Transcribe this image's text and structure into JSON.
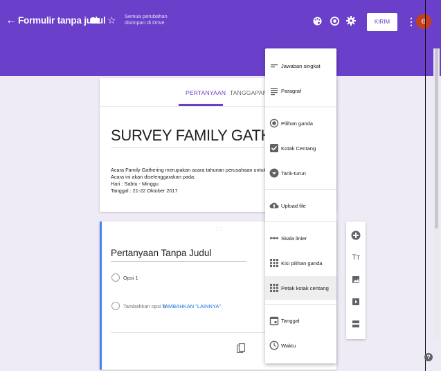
{
  "header": {
    "back_glyph": "←",
    "form_title": "Formulir tanpa judul",
    "star_glyph": "☆",
    "save_status": "Semua perubahan disimpan di Drive",
    "send_label": "KIRIM",
    "more_glyph": "⋮",
    "avatar_letter": "e",
    "icons": [
      "back-arrow-icon",
      "folder-icon",
      "star-icon",
      "palette-icon",
      "eye-icon",
      "gear-icon",
      "more-vert-icon"
    ],
    "colors": {
      "theme": "#6a3fc9",
      "avatar": "#c5401a",
      "background": "#efebf6"
    }
  },
  "tabs": [
    {
      "label": "PERTANYAAN",
      "active": true
    },
    {
      "label": "TANGGAPAN",
      "active": false
    }
  ],
  "form": {
    "title": "SURVEY FAMILY GATHERING",
    "description_lines": [
      "Acara Family Gathering merupakan acara tahunan perusahaan untuk mempererat hubungan",
      "Acara ini akan diselenggarakan pada:",
      "Hari : Sabtu - Minggu",
      "Tanggal : 21-22 Oktober 2017"
    ]
  },
  "question": {
    "drag_handle": ":::",
    "title": "Pertanyaan Tanpa Judul",
    "option_1": "Opsi 1",
    "add_option": "Tambahkan opsi",
    "or_word": "or",
    "add_other": "TAMBAHKAN \"LAINNYA\""
  },
  "question_type_menu": {
    "items": [
      {
        "label": "Jawaban singkat",
        "icon": "short-answer-icon"
      },
      {
        "label": "Paragraf",
        "icon": "paragraph-icon"
      },
      {
        "label": "Pilihan ganda",
        "icon": "radio-icon"
      },
      {
        "label": "Kotak Centang",
        "icon": "checkbox-icon"
      },
      {
        "label": "Tarik-turun",
        "icon": "dropdown-icon"
      },
      {
        "label": "Upload file",
        "icon": "cloud-upload-icon"
      },
      {
        "label": "Skala linier",
        "icon": "linear-scale-icon"
      },
      {
        "label": "Kisi pilihan ganda",
        "icon": "grid-icon"
      },
      {
        "label": "Petak kotak centang",
        "icon": "checkbox-grid-icon",
        "highlighted": true
      },
      {
        "label": "Tanggal",
        "icon": "calendar-icon"
      },
      {
        "label": "Waktu",
        "icon": "clock-icon"
      }
    ]
  },
  "side_toolbar": {
    "icons": [
      "add-question-icon",
      "add-title-icon",
      "add-image-icon",
      "add-video-icon",
      "add-section-icon"
    ],
    "title_glyph": "Tт"
  },
  "help_glyph": "?"
}
